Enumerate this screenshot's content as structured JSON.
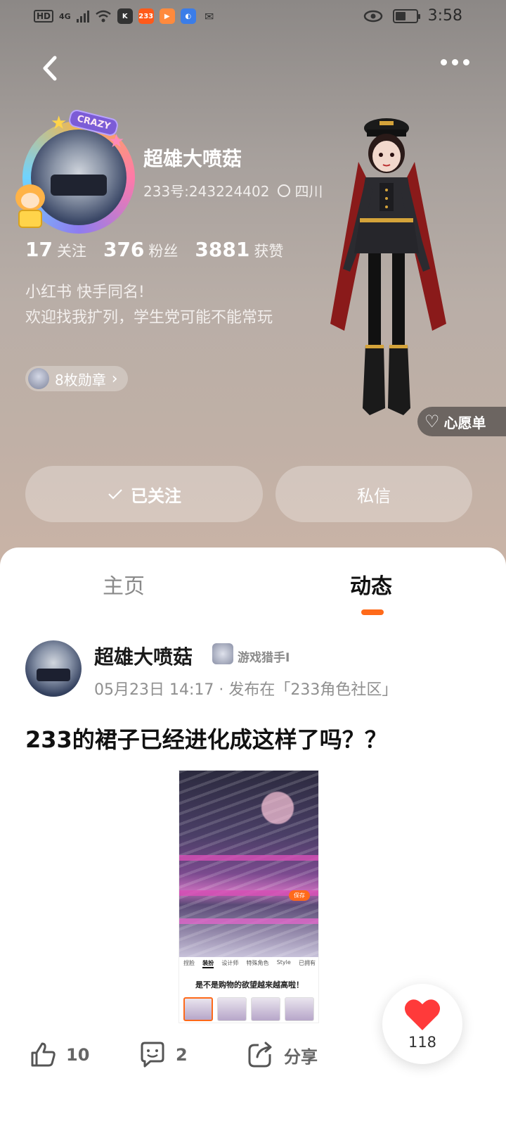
{
  "status_bar": {
    "network": "HD",
    "signal": "4G",
    "apps": [
      "K",
      "233",
      "▶",
      "◐",
      "✉"
    ],
    "time": "3:58"
  },
  "profile": {
    "avatar_badge": "CRAZY",
    "name": "超雄大喷菇",
    "id_line": "233号:243224402",
    "location": "四川",
    "stats": {
      "following_count": "17",
      "following_label": "关注",
      "fans_count": "376",
      "fans_label": "粉丝",
      "likes_count": "3881",
      "likes_label": "获赞"
    },
    "bio": "小红书 快手同名!\n欢迎找我扩列，学生党可能不能常玩",
    "medals_label": "8枚勋章",
    "wishlist_label": "心愿单"
  },
  "actions": {
    "follow_label": "已关注",
    "message_label": "私信"
  },
  "tabs": {
    "home": "主页",
    "feed": "动态"
  },
  "post": {
    "author": "超雄大喷菇",
    "author_badge": "游戏猎手I",
    "meta": "05月23日 14:17 · 发布在「233角色社区」",
    "title": "233的裙子已经进化成这样了吗？？",
    "image": {
      "save_label": "保存",
      "tabs": [
        "捏脸",
        "装扮",
        "设计师",
        "特殊角色",
        "Style",
        "已拥有"
      ],
      "caption": "是不是购物的欲望越来越高啦！"
    },
    "likes": "10",
    "comments": "2",
    "share_label": "分享"
  },
  "floating_like": {
    "count": "118"
  },
  "colors": {
    "accent": "#ff6a1a",
    "heart": "#ff3a3a"
  },
  "icons": [
    "back-arrow-icon",
    "more-dots-icon",
    "location-icon",
    "chevron-right-icon",
    "heart-outline-icon",
    "check-icon",
    "thumbs-up-icon",
    "comment-icon",
    "share-icon",
    "heart-icon"
  ]
}
